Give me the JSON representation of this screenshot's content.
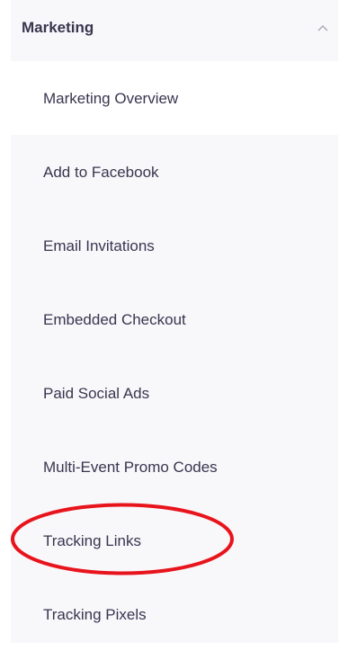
{
  "section": {
    "title": "Marketing",
    "expanded": true,
    "chevron_icon": "chevron-up-icon"
  },
  "overview": {
    "label": "Marketing Overview"
  },
  "items": [
    {
      "label": "Add to Facebook"
    },
    {
      "label": "Email Invitations"
    },
    {
      "label": "Embedded Checkout"
    },
    {
      "label": "Paid Social Ads"
    },
    {
      "label": "Multi-Event Promo Codes"
    },
    {
      "label": "Tracking Links",
      "highlighted": true
    },
    {
      "label": "Tracking Pixels"
    }
  ],
  "colors": {
    "text": "#39364f",
    "section_bg": "#f8f7fa",
    "highlight": "#e8141c",
    "chevron": "#a9a8b3"
  }
}
